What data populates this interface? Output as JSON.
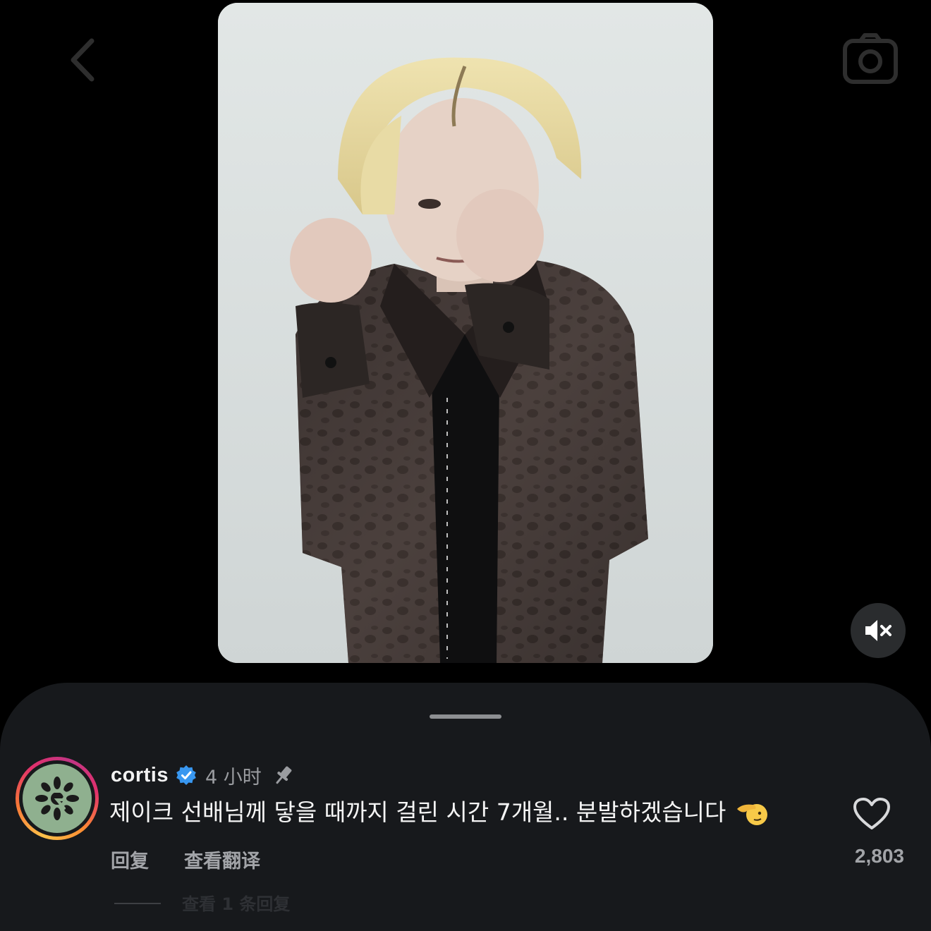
{
  "header": {
    "back_icon": "chevron-left-icon",
    "camera_icon": "camera-icon"
  },
  "video": {
    "muted": true,
    "mute_icon": "speaker-muted-icon"
  },
  "comment": {
    "username": "cortis",
    "verified": true,
    "time": "4 小时",
    "pinned": true,
    "text": "제이크 선배님께 닿을 때까지 걸린 시간 7개월.. 분발하겠습니다",
    "emoji": "saluting-face",
    "reply_label": "回复",
    "translate_label": "查看翻译",
    "like_count": "2,803",
    "replies_label": "查看 1 条回复"
  },
  "colors": {
    "background": "#000000",
    "sheet": "#17191c",
    "verified_blue": "#3897f0",
    "avatar_green": "#8fb08f"
  }
}
